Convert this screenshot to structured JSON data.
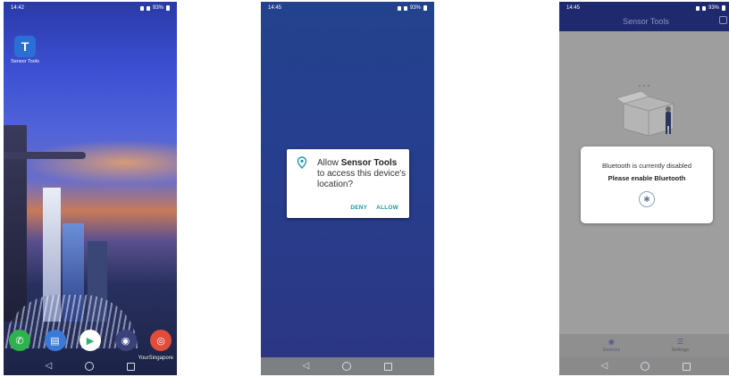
{
  "screens": {
    "home": {
      "status_time": "14:42",
      "status_right": "93%",
      "app_label": "Sensor Tools",
      "app_icon_letter": "T",
      "app_icon_color": "#2b6fd4",
      "watermark": "YourSingapore",
      "dock": [
        {
          "name": "phone-icon",
          "glyph": "✆",
          "color": "#2fb24c"
        },
        {
          "name": "messages-icon",
          "glyph": "▤",
          "color": "#3b79d8"
        },
        {
          "name": "play-store-icon",
          "glyph": "▶",
          "color": "#ffffff"
        },
        {
          "name": "camera-icon",
          "glyph": "◉",
          "color": "#39437a"
        },
        {
          "name": "chrome-icon",
          "glyph": "◎",
          "color": "#e24c3a"
        }
      ]
    },
    "permission": {
      "status_time": "14:45",
      "status_right": "93%",
      "dialog_text_prefix": "Allow ",
      "dialog_app_name": "Sensor Tools",
      "dialog_text_suffix": " to access this device's location?",
      "deny_label": "DENY",
      "allow_label": "ALLOW",
      "accent_color": "#1b9aa5"
    },
    "app": {
      "status_time": "14:45",
      "status_right": "93%",
      "title": "Sensor Tools",
      "dialog_line1": "Bluetooth is currently disabled",
      "dialog_line2": "Please enable Bluetooth",
      "bluetooth_icon": "bluetooth-icon",
      "nav_items": [
        {
          "label": "Devices",
          "icon": "devices-icon",
          "glyph": "◉",
          "active": true
        },
        {
          "label": "Settings",
          "icon": "settings-icon",
          "glyph": "☰",
          "active": false
        }
      ],
      "accent_color": "#1f2a6e"
    }
  },
  "navigation_glyphs": {
    "back": "◁",
    "home": "○",
    "recent": "□"
  }
}
